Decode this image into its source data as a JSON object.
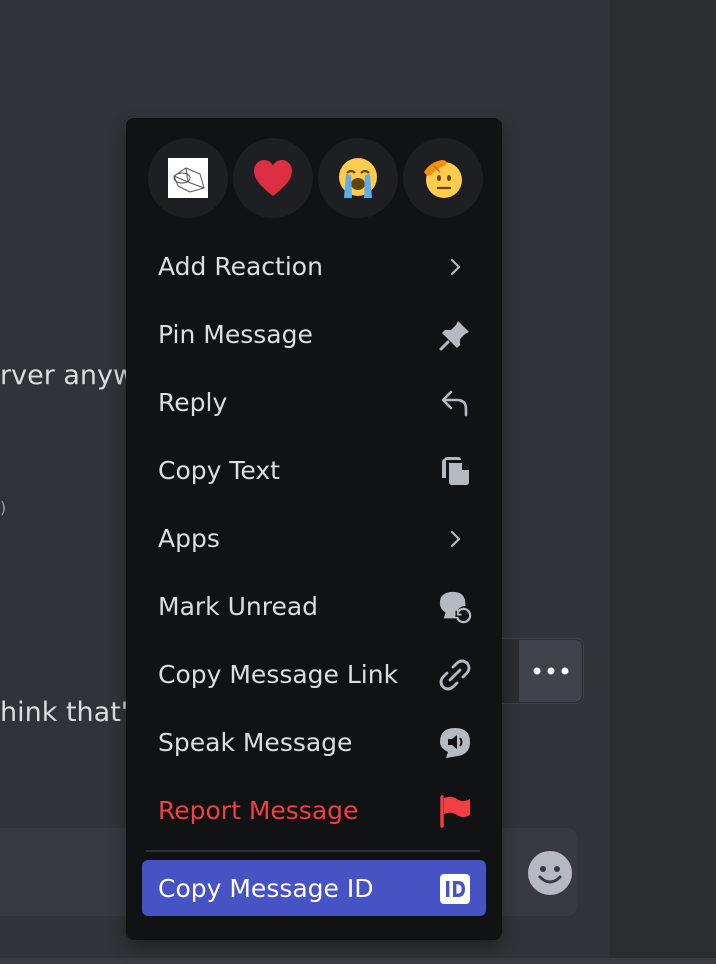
{
  "background_chat": {
    "fragment_1": "rver anyw",
    "fragment_2": "hink that's",
    "fragment_3": ")"
  },
  "hover_toolbar": {
    "more_icon": "ellipsis-icon"
  },
  "context_menu": {
    "quick_reactions": [
      {
        "icon": "custom-sketch-emoji-icon"
      },
      {
        "icon": "heart-emoji-icon"
      },
      {
        "icon": "loudly-crying-emoji-icon"
      },
      {
        "icon": "saluting-face-emoji-icon"
      }
    ],
    "items": [
      {
        "label": "Add Reaction",
        "icon": "chevron-right-icon"
      },
      {
        "label": "Pin Message",
        "icon": "pin-icon"
      },
      {
        "label": "Reply",
        "icon": "reply-arrow-icon"
      },
      {
        "label": "Copy Text",
        "icon": "copy-icon"
      },
      {
        "label": "Apps",
        "icon": "chevron-right-icon"
      },
      {
        "label": "Mark Unread",
        "icon": "mark-unread-icon"
      },
      {
        "label": "Copy Message Link",
        "icon": "link-icon"
      },
      {
        "label": "Speak Message",
        "icon": "speak-icon"
      },
      {
        "label": "Report Message",
        "icon": "flag-icon"
      },
      {
        "label": "Copy Message ID",
        "icon": "id-badge-icon"
      }
    ]
  },
  "colors": {
    "menu_bg": "#111214",
    "danger": "#f23f43",
    "active_bg": "#4752c4",
    "text": "#dbdee1"
  }
}
